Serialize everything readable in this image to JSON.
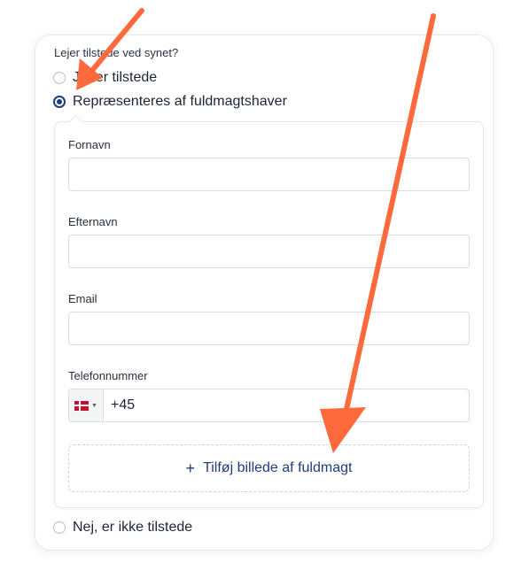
{
  "form": {
    "question": "Lejer tilstede ved synet?",
    "options": [
      {
        "label": "Ja, er tilstede",
        "checked": false
      },
      {
        "label": "Repræsenteres af fuldmagtshaver",
        "checked": true
      },
      {
        "label": "Nej, er ikke tilstede",
        "checked": false
      }
    ],
    "fields": [
      {
        "label": "Fornavn",
        "value": ""
      },
      {
        "label": "Efternavn",
        "value": ""
      },
      {
        "label": "Email",
        "value": ""
      }
    ],
    "phone": {
      "label": "Telefonnummer",
      "country_flag": "denmark-flag-icon",
      "value": "+45"
    },
    "upload": {
      "label": "Tilføj billede af fuldmagt",
      "icon": "plus-icon"
    }
  },
  "colors": {
    "accent": "#1f3d7a",
    "annotation_arrow": "#ff6a3d"
  }
}
